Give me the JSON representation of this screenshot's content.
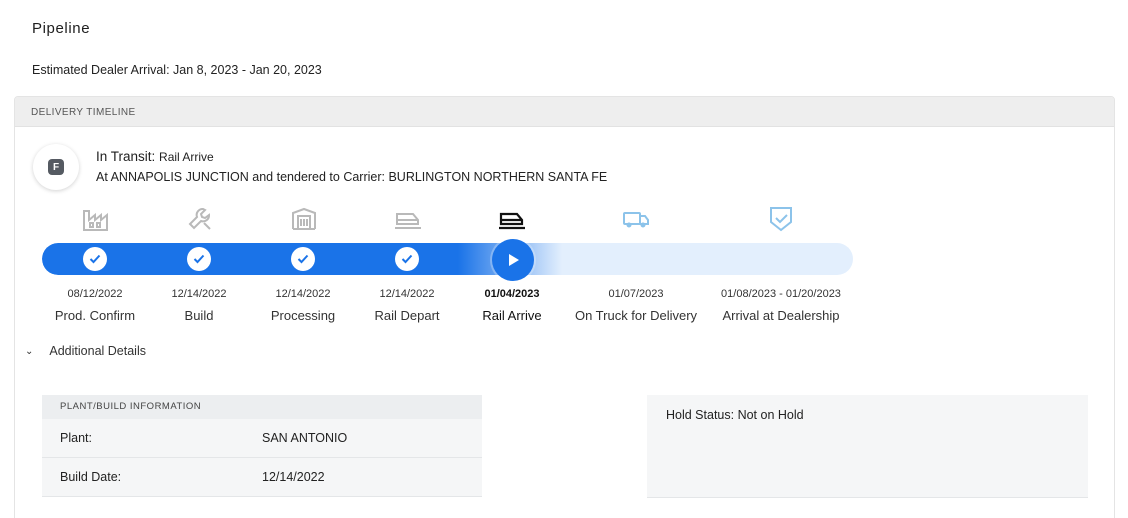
{
  "page": {
    "title": "Pipeline",
    "eta": "Estimated Dealer Arrival: Jan 8, 2023 - Jan 20, 2023"
  },
  "timeline": {
    "header": "DELIVERY TIMELINE",
    "badge_letter": "F",
    "status_label": "In Transit: ",
    "status_sub": "Rail Arrive",
    "location_text": "At ANNAPOLIS JUNCTION and tendered to Carrier: BURLINGTON NORTHERN SANTA FE",
    "progress_fraction": 0.6,
    "accent_color": "#1a73e8",
    "stages": [
      {
        "date": "08/12/2022",
        "name": "Prod. Confirm",
        "icon": "factory-icon",
        "state": "done"
      },
      {
        "date": "12/14/2022",
        "name": "Build",
        "icon": "wrench-icon",
        "state": "done"
      },
      {
        "date": "12/14/2022",
        "name": "Processing",
        "icon": "processing-icon",
        "state": "done"
      },
      {
        "date": "12/14/2022",
        "name": "Rail Depart",
        "icon": "rail-car-icon",
        "state": "done"
      },
      {
        "date": "01/04/2023",
        "name": "Rail Arrive",
        "icon": "rail-car-icon",
        "state": "current"
      },
      {
        "date": "01/07/2023",
        "name": "On Truck for Delivery",
        "icon": "truck-icon",
        "state": "upcoming"
      },
      {
        "date": "01/08/2023 - 01/20/2023",
        "name": "Arrival at Dealership",
        "icon": "shield-check-icon",
        "state": "upcoming"
      }
    ]
  },
  "details": {
    "toggle_label": "Additional Details",
    "plant_header": "PLANT/BUILD INFORMATION",
    "plant_label": "Plant:",
    "plant_value": "SAN ANTONIO",
    "build_date_label": "Build Date:",
    "build_date_value": "12/14/2022",
    "hold_status": "Hold Status: Not on Hold"
  }
}
